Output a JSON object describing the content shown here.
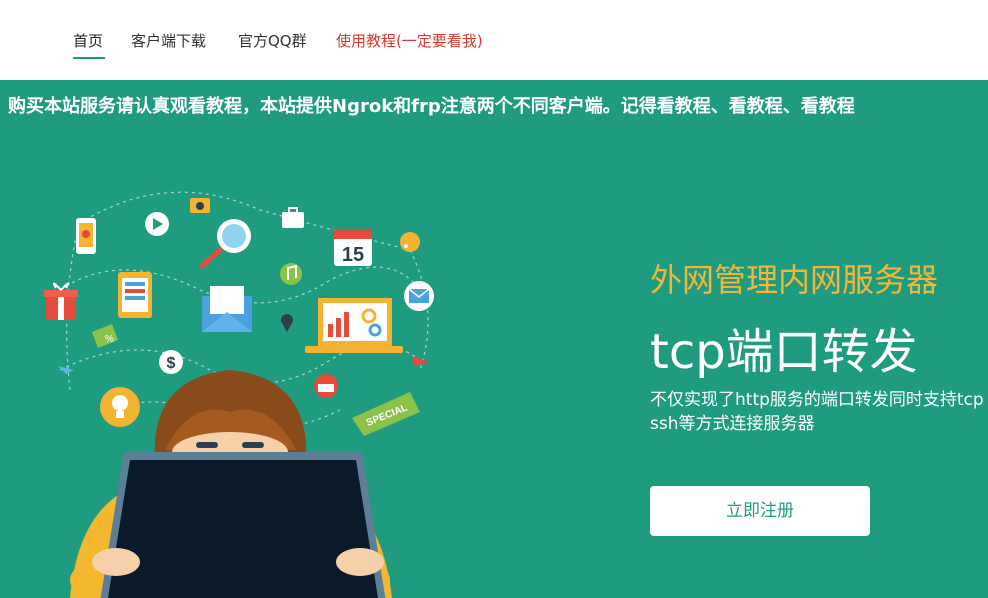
{
  "nav": {
    "items": [
      {
        "label": "首页"
      },
      {
        "label": "客户端下载"
      },
      {
        "label": "官方QQ群"
      },
      {
        "label": "使用教程(一定要看我)"
      }
    ]
  },
  "notice": {
    "text": "购买本站服务请认真观看教程，本站提供Ngrok和frp注意两个不同客户端。记得看教程、看教程、看教程"
  },
  "hero": {
    "subtitle": "外网管理内网服务器",
    "title": "tcp端口转发",
    "description": "不仅实现了http服务的端口转发同时支持tcp ssh等方式连接服务器",
    "register_label": "立即注册",
    "calendar_day": "15",
    "dollar": "$",
    "special": "SPECIAL",
    "percent": "%"
  },
  "colors": {
    "nav_accent": "#1e9b81",
    "hero_bg": "#1f9b80",
    "subtitle": "#f2b73a",
    "tutorial_link": "#d63a2f"
  },
  "icons": [
    "phone-icon",
    "play-icon",
    "camera-icon",
    "search-icon",
    "briefcase-icon",
    "calendar-icon",
    "rss-icon",
    "gift-icon",
    "tablet-icon",
    "music-icon",
    "email-icon",
    "laptop-chart-icon",
    "mail-icon",
    "tag-icon",
    "location-pin-icon",
    "dollar-icon",
    "plane-icon",
    "lightbulb-icon",
    "basket-icon",
    "special-tag-icon"
  ]
}
